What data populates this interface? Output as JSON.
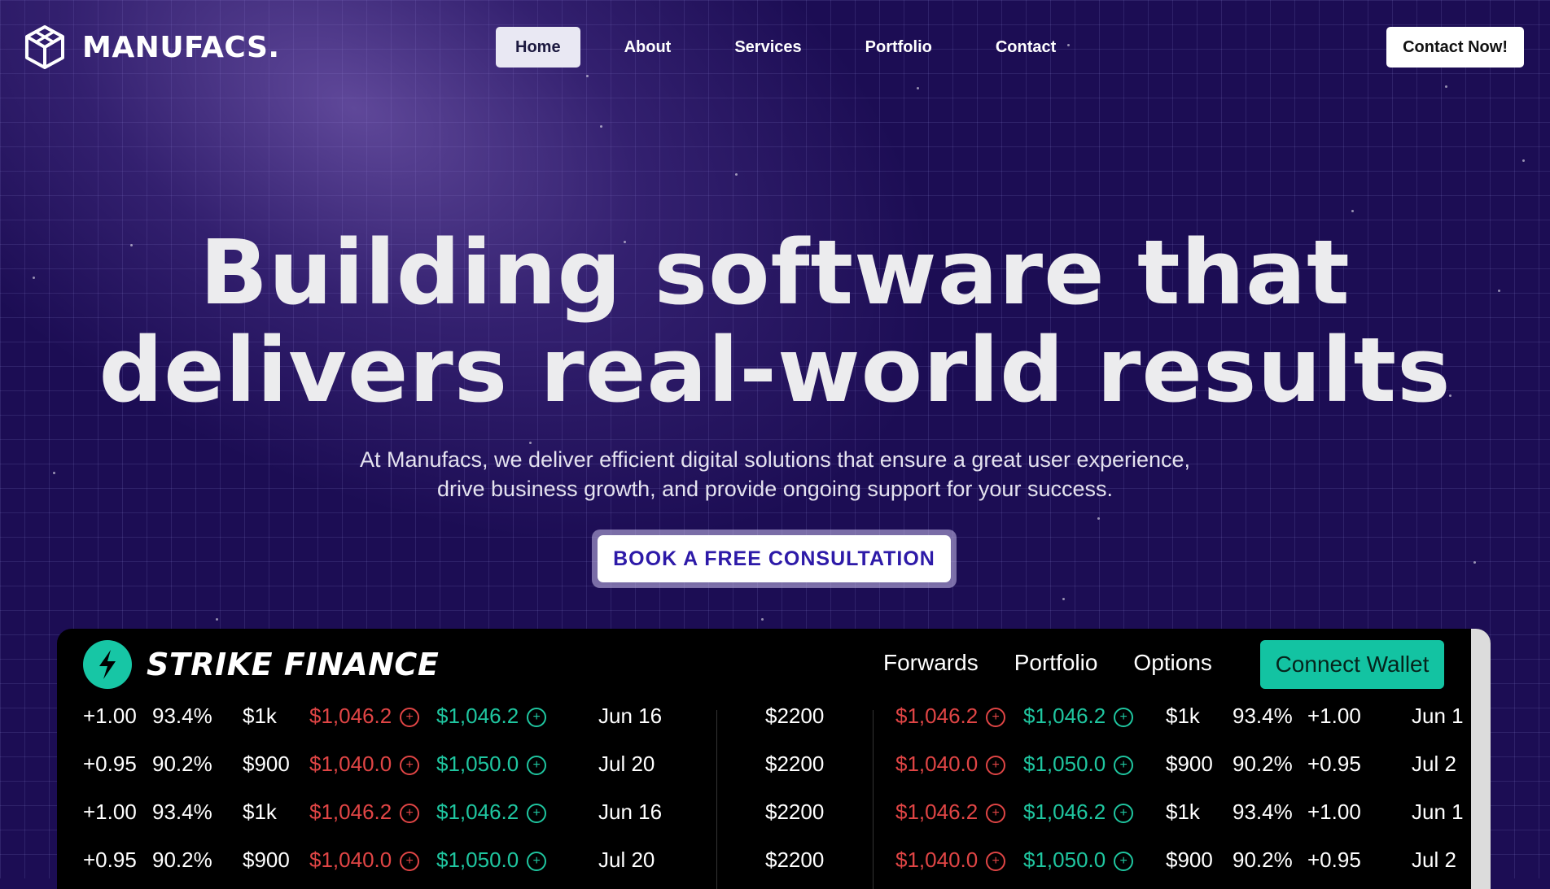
{
  "brand": {
    "name": "MANUFACS.",
    "icon": "cube-icon"
  },
  "nav": {
    "items": [
      "Home",
      "About",
      "Services",
      "Portfolio",
      "Contact"
    ],
    "active": "Home",
    "cta": "Contact Now!"
  },
  "hero": {
    "title_line1": "Building software that",
    "title_line2": "delivers real-world results",
    "subtitle_line1": "At Manufacs, we deliver efficient digital solutions that ensure a great user experience,",
    "subtitle_line2": "drive business growth, and provide ongoing support for your success.",
    "cta": "BOOK A FREE CONSULTATION"
  },
  "dashboard": {
    "brand": "STRIKE FINANCE",
    "nav": [
      "Forwards",
      "Portfolio",
      "Options"
    ],
    "connect": "Connect Wallet",
    "rows": [
      {
        "delta": "+1.00",
        "pct": "93.4%",
        "amt": "$1k",
        "bid": "$1,046.2",
        "ask": "$1,046.2",
        "date": "Jun 16",
        "strike": "$2200",
        "bid2": "$1,046.2",
        "ask2": "$1,046.2",
        "amt2": "$1k",
        "pct2": "93.4%",
        "delta2": "+1.00",
        "date2": "Jun 1"
      },
      {
        "delta": "+0.95",
        "pct": "90.2%",
        "amt": "$900",
        "bid": "$1,040.0",
        "ask": "$1,050.0",
        "date": "Jul 20",
        "strike": "$2200",
        "bid2": "$1,040.0",
        "ask2": "$1,050.0",
        "amt2": "$900",
        "pct2": "90.2%",
        "delta2": "+0.95",
        "date2": "Jul 2"
      },
      {
        "delta": "+1.00",
        "pct": "93.4%",
        "amt": "$1k",
        "bid": "$1,046.2",
        "ask": "$1,046.2",
        "date": "Jun 16",
        "strike": "$2200",
        "bid2": "$1,046.2",
        "ask2": "$1,046.2",
        "amt2": "$1k",
        "pct2": "93.4%",
        "delta2": "+1.00",
        "date2": "Jun 1"
      },
      {
        "delta": "+0.95",
        "pct": "90.2%",
        "amt": "$900",
        "bid": "$1,040.0",
        "ask": "$1,050.0",
        "date": "Jul 20",
        "strike": "$2200",
        "bid2": "$1,040.0",
        "ask2": "$1,050.0",
        "amt2": "$900",
        "pct2": "90.2%",
        "delta2": "+0.95",
        "date2": "Jul 2"
      }
    ]
  },
  "colors": {
    "background": "#1c0d54",
    "accent": "#2d1aa8",
    "teal": "#13c3a2",
    "red": "#e04545"
  }
}
